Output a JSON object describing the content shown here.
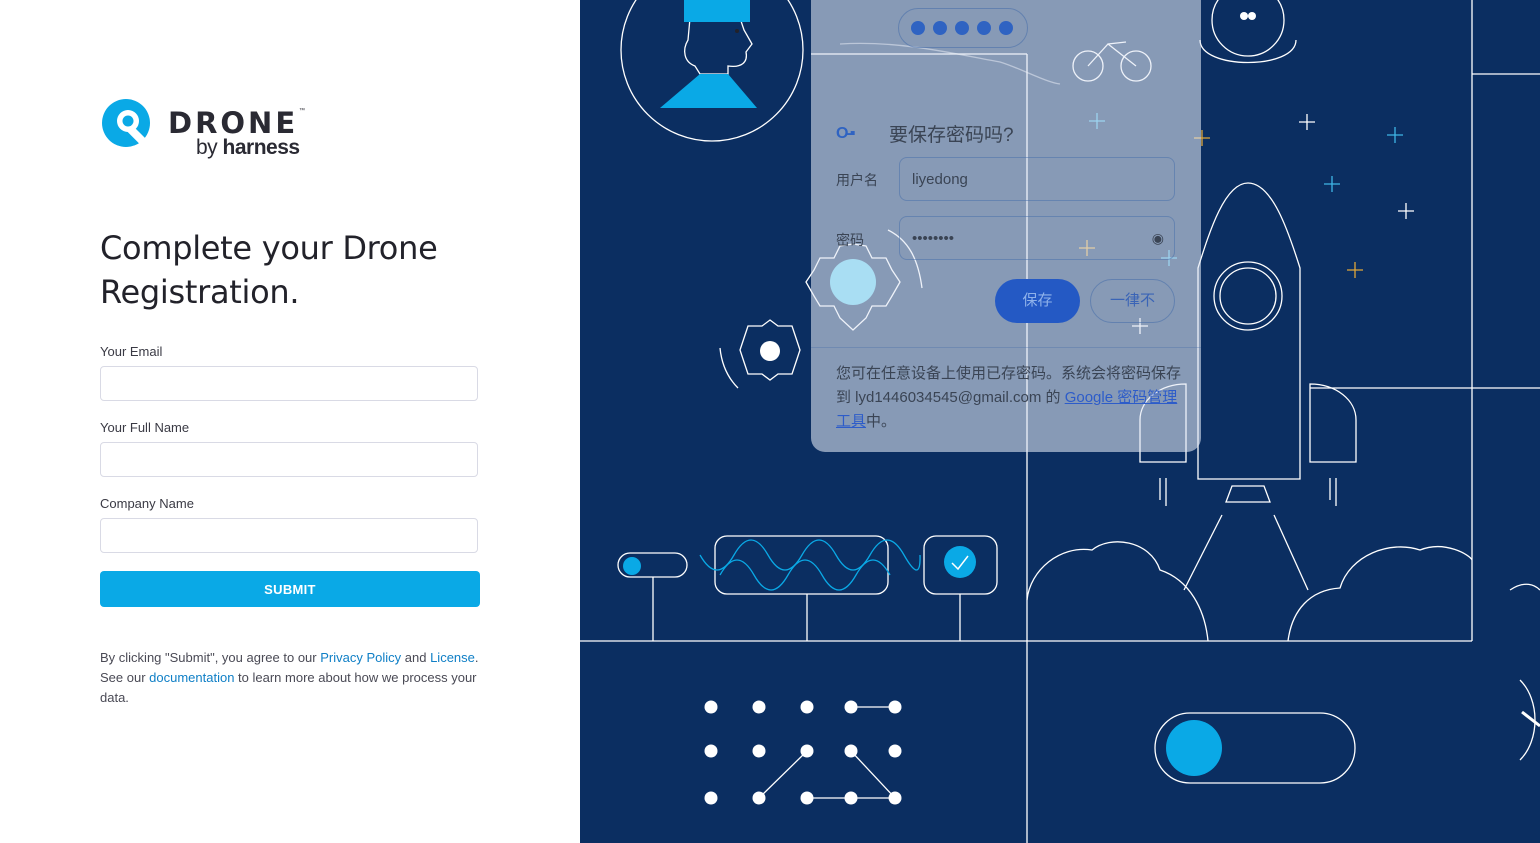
{
  "brand": {
    "name": "DRONE",
    "tm": "™",
    "by": "by",
    "company": "harness"
  },
  "heading": "Complete your Drone Registration.",
  "form": {
    "email_label": "Your Email",
    "email_value": "",
    "fullname_label": "Your Full Name",
    "fullname_value": "",
    "company_label": "Company Name",
    "company_value": "",
    "submit_label": "SUBMIT"
  },
  "legal": {
    "text1": "By clicking \"Submit\", you agree to our ",
    "privacy_link": "Privacy Policy",
    "text2": " and ",
    "license_link": "License",
    "text3": ". See our ",
    "docs_link": "documentation",
    "text4": " to learn more about how we process your data."
  },
  "password_popup": {
    "title": "要保存密码吗?",
    "username_label": "用户名",
    "username_value": "liyedong",
    "password_label": "密码",
    "password_value": "••••••••",
    "save_label": "保存",
    "never_label": "一律不",
    "info_text": "您可在任意设备上使用已存密码。系统会将密码保存到 lyd1446034545@gmail.com 的 ",
    "info_link": "Google 密码管理工具",
    "info_tail": "中。"
  },
  "colors": {
    "accent": "#0aa9e6",
    "illustration_bg": "#0b2e61",
    "link": "#0f7fc6"
  }
}
